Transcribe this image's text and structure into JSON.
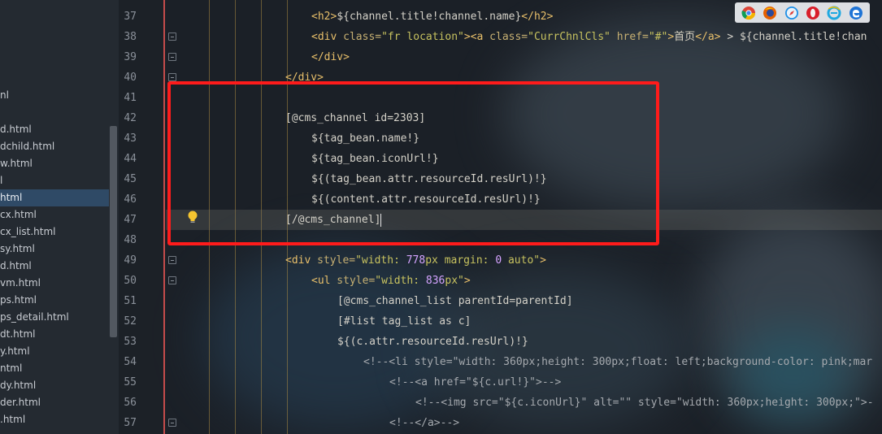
{
  "tree": {
    "items": [
      {
        "label": "nl",
        "selected": false
      },
      {
        "label": "d.html",
        "selected": false
      },
      {
        "label": "dchild.html",
        "selected": false
      },
      {
        "label": "w.html",
        "selected": false
      },
      {
        "label": "l",
        "selected": false
      },
      {
        "label": "html",
        "selected": true
      },
      {
        "label": "cx.html",
        "selected": false
      },
      {
        "label": "cx_list.html",
        "selected": false
      },
      {
        "label": "sy.html",
        "selected": false
      },
      {
        "label": "d.html",
        "selected": false
      },
      {
        "label": "vm.html",
        "selected": false
      },
      {
        "label": "ps.html",
        "selected": false
      },
      {
        "label": "ps_detail.html",
        "selected": false
      },
      {
        "label": "dt.html",
        "selected": false
      },
      {
        "label": "y.html",
        "selected": false
      },
      {
        "label": "ntml",
        "selected": false
      },
      {
        "label": "dy.html",
        "selected": false
      },
      {
        "label": "der.html",
        "selected": false
      },
      {
        "label": ".html",
        "selected": false
      }
    ]
  },
  "editor": {
    "line_numbers": [
      "37",
      "38",
      "39",
      "40",
      "41",
      "42",
      "43",
      "44",
      "45",
      "46",
      "47",
      "48",
      "49",
      "50",
      "51",
      "52",
      "53",
      "54",
      "55",
      "56",
      "57"
    ],
    "lines": {
      "l37": {
        "open": "<h2>",
        "content": "${channel.title!channel.name}",
        "close": "</h2>"
      },
      "l38": {
        "div_open": "<div",
        "class_attr": " class=",
        "class_val": "\"fr location\"",
        "gt": ">",
        "a_open": "<a",
        "a_class_attr": " class=",
        "a_class_val": "\"CurrChnlCls\"",
        "href_attr": " href=",
        "href_val": "\"#\"",
        "a_gt": ">",
        "home_text": "首页",
        "a_close": "</a>",
        "rest": " > ${channel.title!chan"
      },
      "l39": {
        "close": "</div>"
      },
      "l40": {
        "close": "</div>"
      },
      "l42": "[@cms_channel id=2303]",
      "l43": "${tag_bean.name!}",
      "l44": "${tag_bean.iconUrl!}",
      "l45": "${(tag_bean.attr.resourceId.resUrl)!}",
      "l46": "${(content.attr.resourceId.resUrl)!}",
      "l47": "[/@cms_channel]",
      "l49": {
        "open": "<div",
        "style_attr": " style=",
        "q1": "\"width: ",
        "w": "778",
        "u1": "px",
        "mid": " margin: ",
        "m": "0",
        "end": " auto\"",
        "gt": ">"
      },
      "l50": {
        "open": "<ul",
        "style_attr": " style=",
        "q1": "\"width: ",
        "w": "836",
        "u1": "px\"",
        "gt": ">"
      },
      "l51": "[@cms_channel_list parentId=parentId]",
      "l52": "[#list tag_list as c]",
      "l53": "${(c.attr.resourceId.resUrl)!}",
      "l54": "<!--<li style=\"width: 360px;height: 300px;float: left;background-color: pink;mar",
      "l55": "<!--<a href=\"${c.url!}\">-->",
      "l56": "<!--<img src=\"${c.iconUrl}\" alt=\"\" style=\"width: 360px;height: 300px;\">-",
      "l57": "<!--</a>-->"
    }
  },
  "browsers": [
    "chrome-icon",
    "firefox-icon",
    "safari-icon",
    "opera-icon",
    "ie-icon",
    "edge-icon"
  ],
  "colors": {
    "highlight_box": "#ff1b1b",
    "selected_tree_item": "#2f4a66"
  }
}
